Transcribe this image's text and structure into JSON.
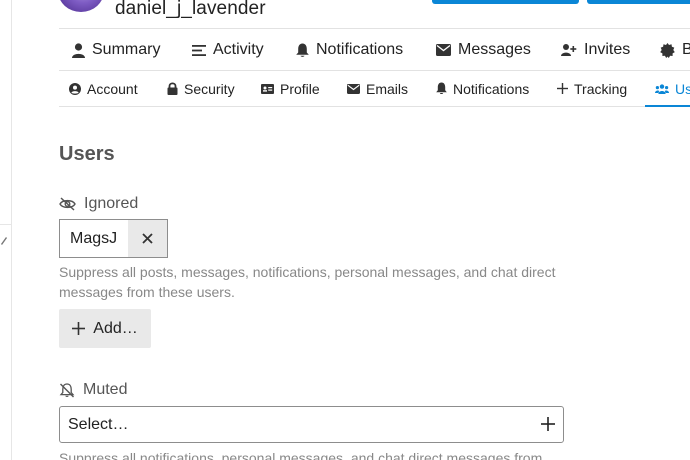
{
  "user": {
    "username": "daniel_j_lavender"
  },
  "primary_nav": [
    {
      "label": "Summary",
      "icon": "user-icon"
    },
    {
      "label": "Activity",
      "icon": "activity-list-icon"
    },
    {
      "label": "Notifications",
      "icon": "bell-icon"
    },
    {
      "label": "Messages",
      "icon": "envelope-icon"
    },
    {
      "label": "Invites",
      "icon": "user-plus-icon"
    },
    {
      "label": "B",
      "icon": "badge-icon"
    }
  ],
  "secondary_nav": [
    {
      "label": "Account",
      "icon": "user-circle-icon"
    },
    {
      "label": "Security",
      "icon": "lock-icon"
    },
    {
      "label": "Profile",
      "icon": "id-card-icon"
    },
    {
      "label": "Emails",
      "icon": "envelope-icon"
    },
    {
      "label": "Notifications",
      "icon": "bell-icon"
    },
    {
      "label": "Tracking",
      "icon": "plus-icon"
    },
    {
      "label": "Us",
      "icon": "users-icon",
      "active": true
    }
  ],
  "main": {
    "title": "Users",
    "ignored": {
      "label": "Ignored",
      "users": [
        "MagsJ"
      ],
      "description_line1": "Suppress all posts, messages, notifications, personal messages, and chat direct",
      "description_line2": "messages from these users.",
      "add_label": "Add…"
    },
    "muted": {
      "label": "Muted",
      "placeholder": "Select…",
      "description": "Suppress all notifications, personal messages, and chat direct messages from"
    }
  },
  "colors": {
    "accent": "#0a86d6",
    "muted_text": "#888888",
    "button_bg": "#e9e9e9"
  }
}
